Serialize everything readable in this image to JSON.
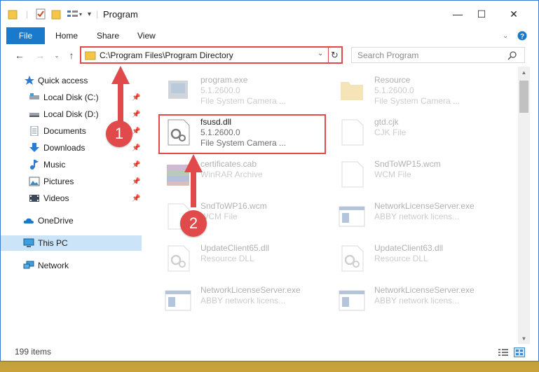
{
  "window": {
    "title": "Program",
    "controls": {
      "minimize": "—",
      "maximize": "☐",
      "close": "✕"
    }
  },
  "ribbon": {
    "file": "File",
    "tabs": [
      "Home",
      "Share",
      "View"
    ]
  },
  "nav": {
    "address": "C:\\Program Files\\Program Directory",
    "search_placeholder": "Search Program"
  },
  "sidebar": {
    "items": [
      {
        "label": "Quick access",
        "icon": "star-icon",
        "pinned": false
      },
      {
        "label": "Local Disk (C:)",
        "icon": "drive-icon",
        "pinned": true
      },
      {
        "label": "Local Disk (D:)",
        "icon": "drive-icon",
        "pinned": true
      },
      {
        "label": "Documents",
        "icon": "documents-icon",
        "pinned": true
      },
      {
        "label": "Downloads",
        "icon": "downloads-icon",
        "pinned": true
      },
      {
        "label": "Music",
        "icon": "music-icon",
        "pinned": true
      },
      {
        "label": "Pictures",
        "icon": "pictures-icon",
        "pinned": true
      },
      {
        "label": "Videos",
        "icon": "videos-icon",
        "pinned": true
      },
      {
        "label": "OneDrive",
        "icon": "onedrive-icon",
        "pinned": false
      },
      {
        "label": "This PC",
        "icon": "pc-icon",
        "pinned": false,
        "selected": true
      },
      {
        "label": "Network",
        "icon": "network-icon",
        "pinned": false
      }
    ]
  },
  "files": [
    {
      "name": "program.exe",
      "line2": "5.1.2600.0",
      "line3": "File System Camera ...",
      "icon": "exe-icon"
    },
    {
      "name": "Resource",
      "line2": "5.1.2600.0",
      "line3": "File System Camera ...",
      "icon": "folder-icon"
    },
    {
      "name": "fsusd.dll",
      "line2": "5.1.2600.0",
      "line3": "File System Camera ...",
      "icon": "dll-icon"
    },
    {
      "name": "gtd.cjk",
      "line2": "CJK File",
      "line3": "",
      "icon": "file-icon"
    },
    {
      "name": "certificates.cab",
      "line2": "WinRAR Archive",
      "line3": "",
      "icon": "archive-icon"
    },
    {
      "name": "SndToWP15.wcm",
      "line2": "WCM File",
      "line3": "",
      "icon": "file-icon"
    },
    {
      "name": "SndToWP16.wcm",
      "line2": "WCM File",
      "line3": "",
      "icon": "file-icon"
    },
    {
      "name": "NetworkLicenseServer.exe",
      "line2": "ABBY network licens...",
      "line3": "",
      "icon": "window-icon"
    },
    {
      "name": "UpdateClient65.dll",
      "line2": "Resource DLL",
      "line3": "",
      "icon": "dll-icon"
    },
    {
      "name": "UpdateClient63.dll",
      "line2": "Resource DLL",
      "line3": "",
      "icon": "dll-icon"
    },
    {
      "name": "NetworkLicenseServer.exe",
      "line2": "ABBY network licens...",
      "line3": "",
      "icon": "window-icon"
    },
    {
      "name": "NetworkLicenseServer.exe",
      "line2": "ABBY network licens...",
      "line3": "",
      "icon": "window-icon"
    }
  ],
  "status": {
    "count": "199 items"
  },
  "annotations": {
    "step1": "1",
    "step2": "2"
  },
  "colors": {
    "accent": "#1979ca",
    "highlight": "#e04a4a",
    "selection": "#cce4f7"
  }
}
